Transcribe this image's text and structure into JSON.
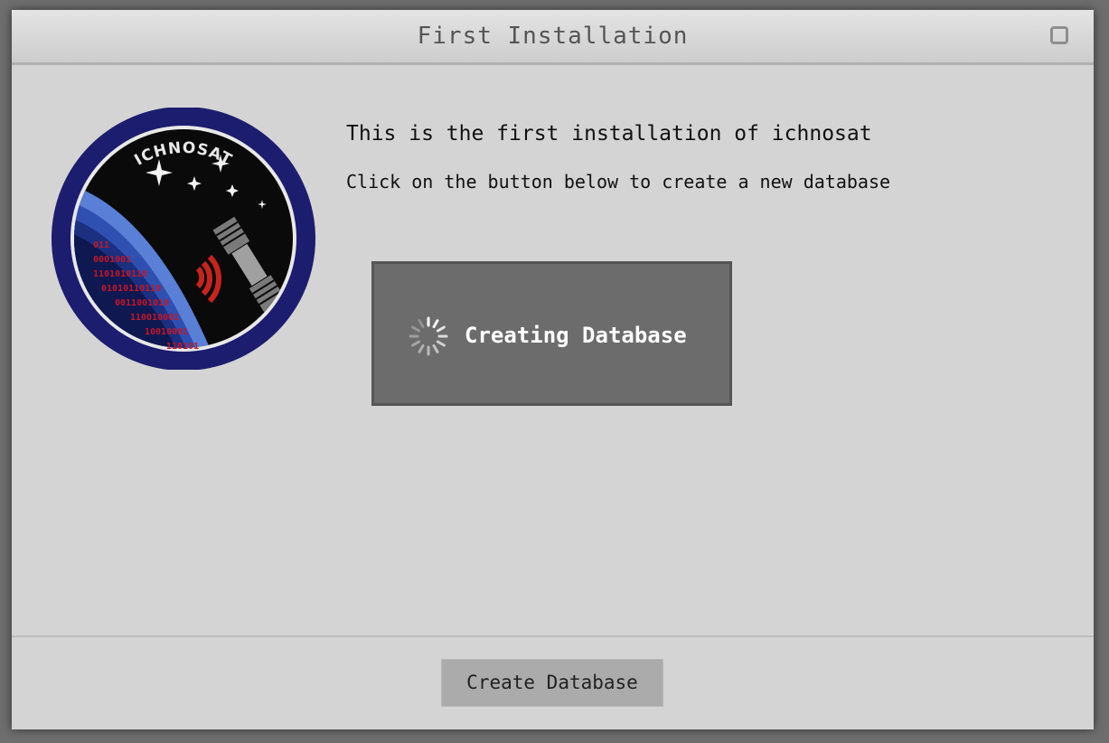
{
  "window": {
    "title": "First Installation"
  },
  "logo": {
    "text": "ICHNOSAT",
    "binary_lines": [
      "011",
      "0001001",
      "1101010110",
      "01010110110",
      "0011001010",
      "110010001",
      "10010001",
      "110101"
    ]
  },
  "content": {
    "heading": "This is the first installation of ichnosat",
    "instruction": "Click on the button below to create a new database"
  },
  "progress": {
    "label": "Creating Database"
  },
  "footer": {
    "create_button_label": "Create Database"
  },
  "colors": {
    "window_bg": "#d4d4d4",
    "progress_bg": "#6c6c6c",
    "button_bg": "#ababab",
    "logo_ring": "#1c1d6e",
    "logo_binary": "#c0182a"
  }
}
